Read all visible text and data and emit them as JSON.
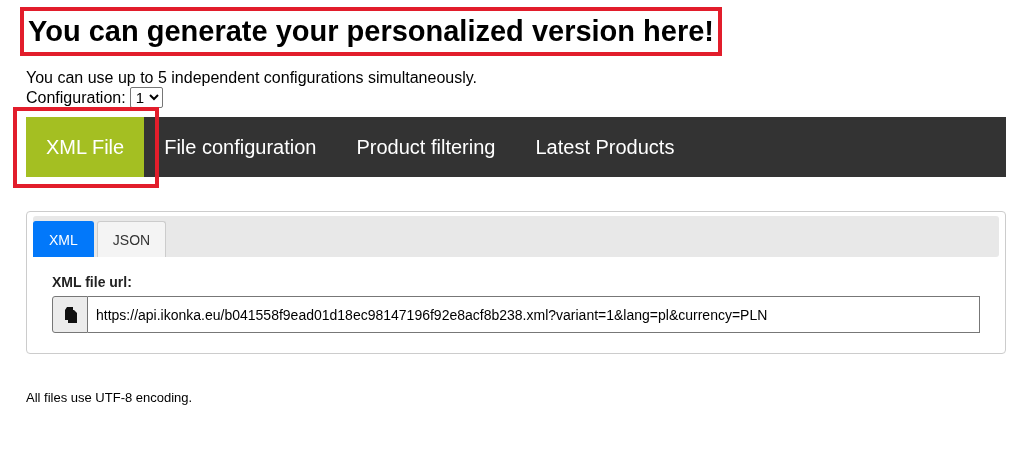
{
  "heading": {
    "text": "You can generate your personalized version here!",
    "highlighted": true
  },
  "intro": "You can use up to 5 independent configurations simultaneously.",
  "configuration": {
    "label": "Configuration:",
    "value": "1"
  },
  "nav": [
    {
      "label": "XML File",
      "selected": true,
      "highlighted": true
    },
    {
      "label": "File configuration",
      "selected": false,
      "highlighted": false
    },
    {
      "label": "Product filtering",
      "selected": false,
      "highlighted": false
    },
    {
      "label": "Latest Products",
      "selected": false,
      "highlighted": false
    }
  ],
  "format_tabs": [
    {
      "label": "XML",
      "selected": true
    },
    {
      "label": "JSON",
      "selected": false
    }
  ],
  "url_field": {
    "label": "XML file url:",
    "value": "https://api.ikonka.eu/b041558f9ead01d18ec98147196f92e8acf8b238.xml?variant=1&lang=pl&currency=PLN"
  },
  "footer": "All files use UTF-8 encoding."
}
